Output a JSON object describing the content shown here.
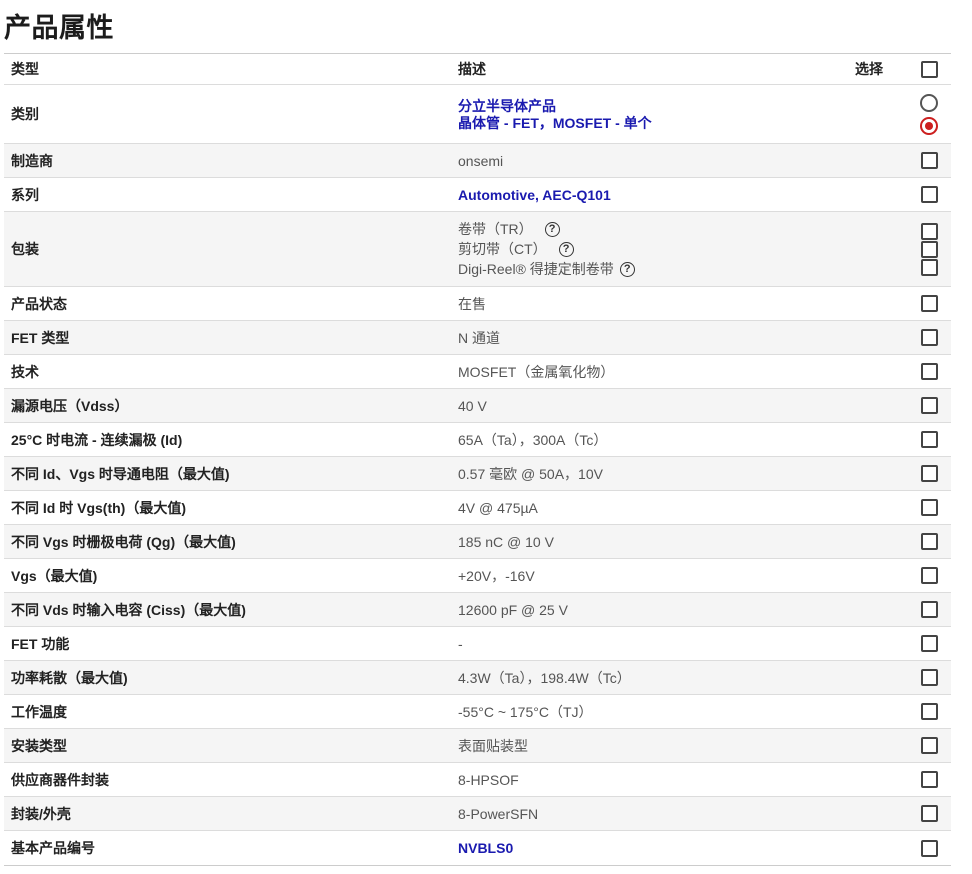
{
  "title": "产品属性",
  "header": {
    "type": "类型",
    "desc": "描述",
    "select": "选择"
  },
  "category": {
    "label": "类别",
    "options": [
      "分立半导体产品",
      "晶体管 - FET，MOSFET - 单个"
    ],
    "selected_index": 1
  },
  "packaging": {
    "label": "包装",
    "options": [
      "卷带（TR）",
      "剪切带（CT）",
      "Digi-Reel® 得捷定制卷带"
    ],
    "help_icon": "?"
  },
  "rows": [
    {
      "label": "制造商",
      "value": "onsemi",
      "link": false
    },
    {
      "label": "系列",
      "value": "Automotive, AEC-Q101",
      "link": true
    },
    {
      "label": "产品状态",
      "value": "在售",
      "link": false
    },
    {
      "label": "FET 类型",
      "value": "N 通道",
      "link": false
    },
    {
      "label": "技术",
      "value": "MOSFET（金属氧化物）",
      "link": false
    },
    {
      "label": "漏源电压（Vdss）",
      "value": "40 V",
      "link": false
    },
    {
      "label": "25°C 时电流 - 连续漏极 (Id)",
      "value": "65A（Ta），300A（Tc）",
      "link": false
    },
    {
      "label": "不同 Id、Vgs 时导通电阻（最大值)",
      "value": "0.57 毫欧 @ 50A，10V",
      "link": false
    },
    {
      "label": "不同 Id 时 Vgs(th)（最大值)",
      "value": "4V @ 475µA",
      "link": false
    },
    {
      "label": "不同 Vgs 时栅极电荷 (Qg)（最大值)",
      "value": "185 nC @ 10 V",
      "link": false
    },
    {
      "label": "Vgs（最大值)",
      "value": "+20V，-16V",
      "link": false
    },
    {
      "label": "不同 Vds 时输入电容 (Ciss)（最大值)",
      "value": "12600 pF @ 25 V",
      "link": false
    },
    {
      "label": "FET 功能",
      "value": "-",
      "link": false
    },
    {
      "label": "功率耗散（最大值)",
      "value": "4.3W（Ta），198.4W（Tc）",
      "link": false
    },
    {
      "label": "工作温度",
      "value": "-55°C ~ 175°C（TJ）",
      "link": false
    },
    {
      "label": "安装类型",
      "value": "表面贴装型",
      "link": false
    },
    {
      "label": "供应商器件封装",
      "value": "8-HPSOF",
      "link": false
    },
    {
      "label": "封装/外壳",
      "value": "8-PowerSFN",
      "link": false
    },
    {
      "label": "基本产品编号",
      "value": "NVBLS0",
      "link": true
    }
  ]
}
